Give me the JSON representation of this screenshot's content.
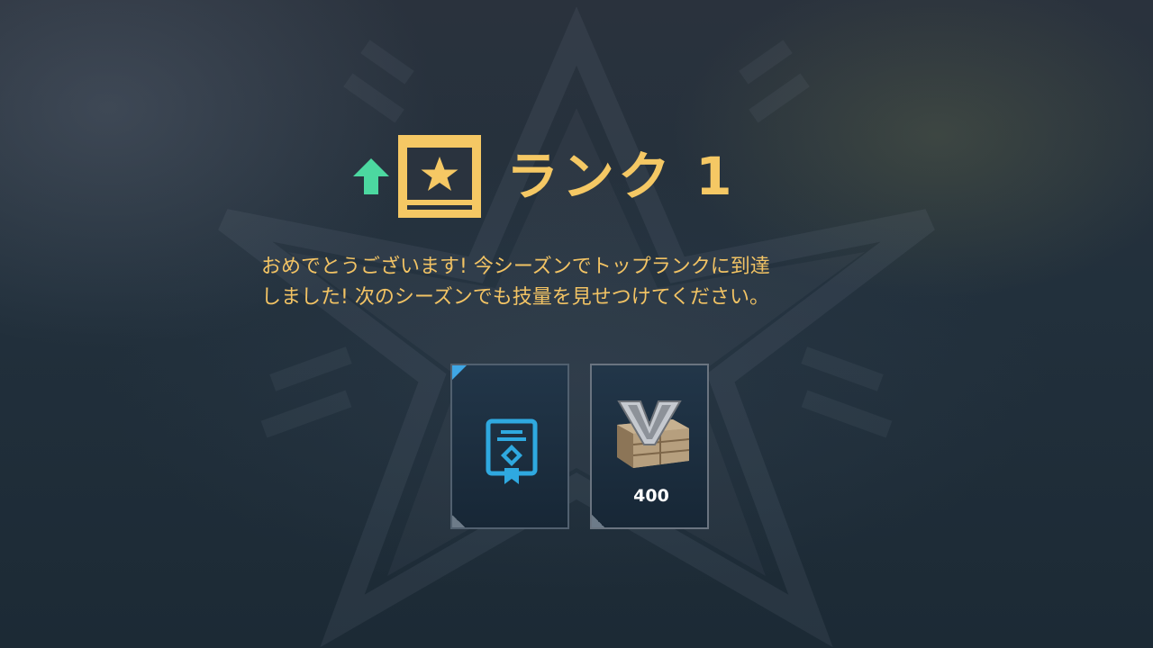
{
  "title": {
    "rank_label": "ランク 1"
  },
  "message": "おめでとうございます! 今シーズンでトップランクに到達\nしました! 次のシーズンでも技量を見せつけてください。",
  "rewards": [
    {
      "icon": "certificate-icon",
      "count": null
    },
    {
      "icon": "crate-icon",
      "count": "400"
    }
  ],
  "colors": {
    "title": "#f5c864",
    "message": "#f2c364",
    "arrow": "#4cd8a0",
    "badge": "#f5c864",
    "card_accent": "#3fa7e6",
    "certificate": "#2fa9e0"
  }
}
